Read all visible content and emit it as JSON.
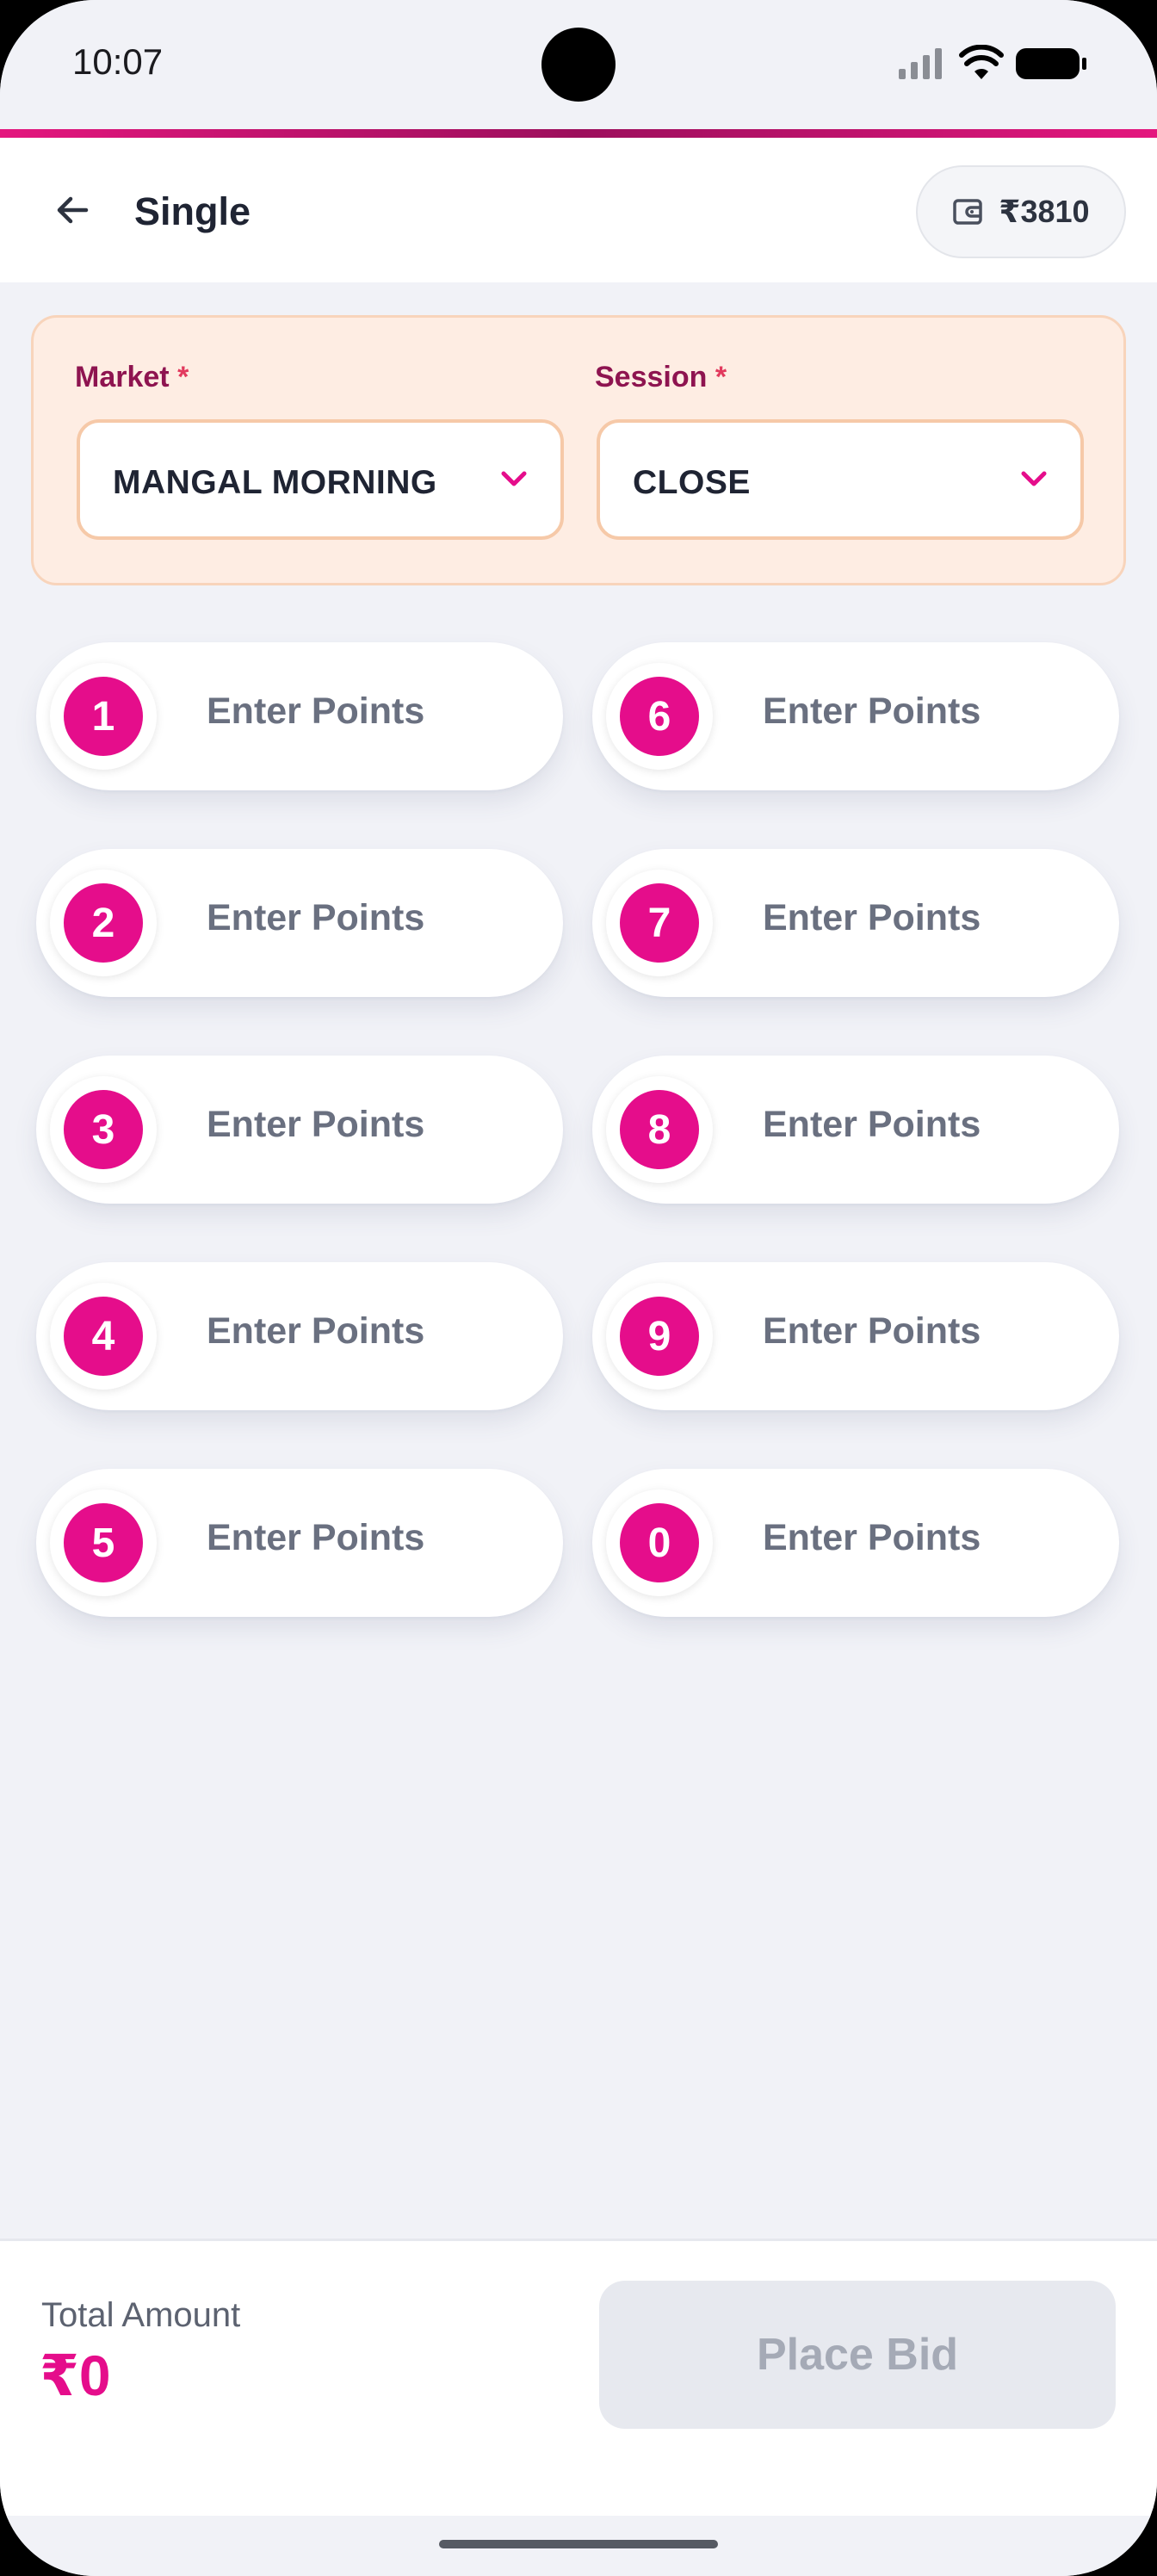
{
  "status_bar": {
    "time": "10:07"
  },
  "header": {
    "title": "Single",
    "wallet_balance": "₹3810"
  },
  "selectors": {
    "market": {
      "label": "Market",
      "required_mark": "*",
      "value": "MANGAL MORNING"
    },
    "session": {
      "label": "Session",
      "required_mark": "*",
      "value": "CLOSE"
    }
  },
  "digits": [
    {
      "digit": "1",
      "placeholder": "Enter Points"
    },
    {
      "digit": "2",
      "placeholder": "Enter Points"
    },
    {
      "digit": "3",
      "placeholder": "Enter Points"
    },
    {
      "digit": "4",
      "placeholder": "Enter Points"
    },
    {
      "digit": "5",
      "placeholder": "Enter Points"
    },
    {
      "digit": "6",
      "placeholder": "Enter Points"
    },
    {
      "digit": "7",
      "placeholder": "Enter Points"
    },
    {
      "digit": "8",
      "placeholder": "Enter Points"
    },
    {
      "digit": "9",
      "placeholder": "Enter Points"
    },
    {
      "digit": "0",
      "placeholder": "Enter Points"
    }
  ],
  "footer": {
    "total_label": "Total Amount",
    "total_value": "₹0",
    "place_bid_label": "Place Bid"
  },
  "colors": {
    "accent": "#e50d8b",
    "brand_dark": "#8e1450",
    "selector_bg": "#feede3",
    "disabled_button": "#e7e9ef"
  },
  "icons": [
    "back-arrow-icon",
    "wallet-icon",
    "chevron-down-icon",
    "signal-icon",
    "wifi-icon",
    "battery-icon"
  ]
}
